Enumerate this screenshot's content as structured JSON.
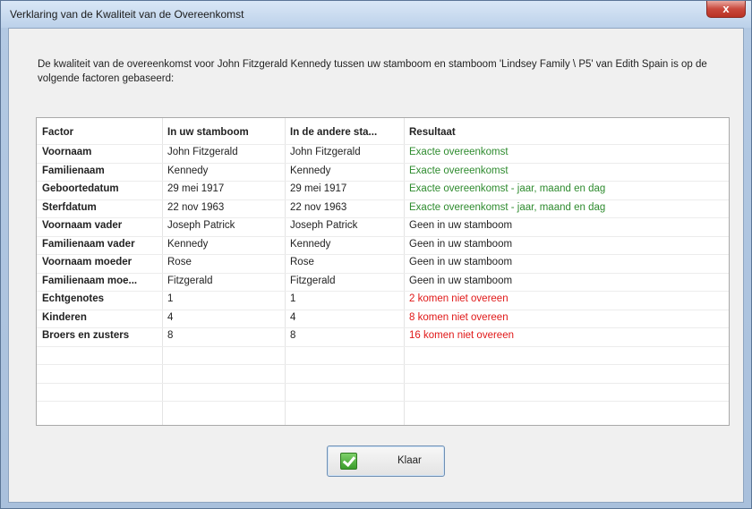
{
  "window": {
    "title": "Verklaring van de Kwaliteit van de Overeenkomst",
    "close_label": "x"
  },
  "intro": "De kwaliteit van de overeenkomst voor John Fitzgerald Kennedy tussen uw stamboom en stamboom 'Lindsey Family \\ P5' van Edith Spain is op de volgende factoren gebaseerd:",
  "table": {
    "headers": [
      "Factor",
      "In uw stamboom",
      "In de andere sta...",
      "Resultaat"
    ],
    "rows": [
      {
        "factor": "Voornaam",
        "mine": "John Fitzgerald",
        "other": "John Fitzgerald",
        "result": "Exacte overeenkomst",
        "status": "match"
      },
      {
        "factor": "Familienaam",
        "mine": "Kennedy",
        "other": "Kennedy",
        "result": "Exacte overeenkomst",
        "status": "match"
      },
      {
        "factor": "Geboortedatum",
        "mine": "29 mei 1917",
        "other": "29 mei 1917",
        "result": "Exacte overeenkomst - jaar, maand en dag",
        "status": "match"
      },
      {
        "factor": "Sterfdatum",
        "mine": "22 nov 1963",
        "other": "22 nov 1963",
        "result": "Exacte overeenkomst - jaar, maand en dag",
        "status": "match"
      },
      {
        "factor": "Voornaam vader",
        "mine": "Joseph Patrick",
        "other": "Joseph Patrick",
        "result": "Geen in uw stamboom",
        "status": "none"
      },
      {
        "factor": "Familienaam vader",
        "mine": "Kennedy",
        "other": "Kennedy",
        "result": "Geen in uw stamboom",
        "status": "none"
      },
      {
        "factor": "Voornaam moeder",
        "mine": "Rose",
        "other": "Rose",
        "result": "Geen in uw stamboom",
        "status": "none"
      },
      {
        "factor": "Familienaam moe...",
        "mine": "Fitzgerald",
        "other": "Fitzgerald",
        "result": "Geen in uw stamboom",
        "status": "none"
      },
      {
        "factor": "Echtgenotes",
        "mine": "1",
        "other": "1",
        "result": "2 komen niet overeen",
        "status": "mismatch"
      },
      {
        "factor": "Kinderen",
        "mine": "4",
        "other": "4",
        "result": "8 komen niet overeen",
        "status": "mismatch"
      },
      {
        "factor": "Broers en zusters",
        "mine": "8",
        "other": "8",
        "result": "16 komen niet overeen",
        "status": "mismatch"
      }
    ]
  },
  "colors": {
    "match": "#2e8b2e",
    "mismatch": "#e01818",
    "none": "#222222"
  },
  "button": {
    "label": "Klaar",
    "icon": "checkmark-icon"
  }
}
